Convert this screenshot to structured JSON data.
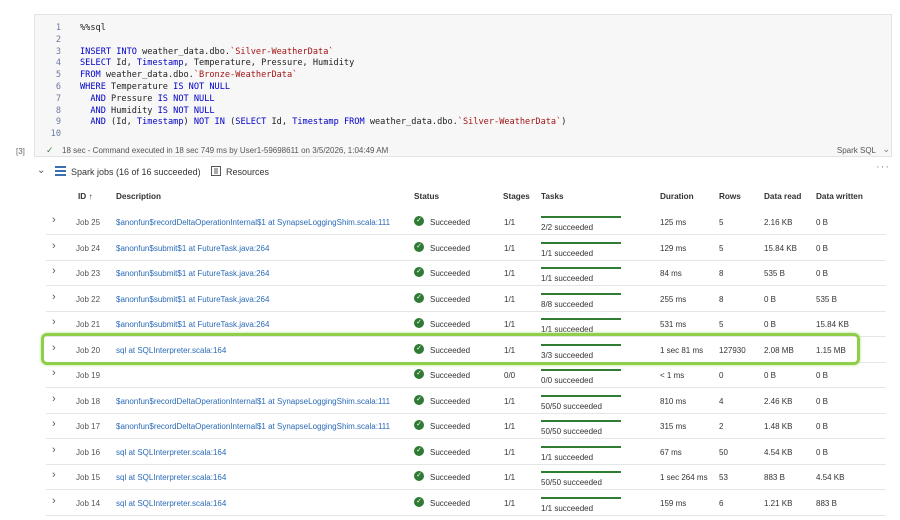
{
  "code": {
    "lines": [
      {
        "num": "1",
        "parts": [
          {
            "t": "%%sql",
            "c": ""
          }
        ]
      },
      {
        "num": "2",
        "parts": []
      },
      {
        "num": "3",
        "parts": [
          {
            "t": "INSERT INTO",
            "c": "kw"
          },
          {
            "t": " weather_data.dbo.",
            "c": ""
          },
          {
            "t": "`Silver-WeatherData`",
            "c": "str"
          }
        ]
      },
      {
        "num": "4",
        "parts": [
          {
            "t": "SELECT",
            "c": "kw"
          },
          {
            "t": " Id, ",
            "c": ""
          },
          {
            "t": "Timestamp",
            "c": "kw"
          },
          {
            "t": ", Temperature, Pressure, Humidity",
            "c": ""
          }
        ]
      },
      {
        "num": "5",
        "parts": [
          {
            "t": "FROM",
            "c": "kw"
          },
          {
            "t": " weather_data.dbo.",
            "c": ""
          },
          {
            "t": "`Bronze-WeatherData`",
            "c": "str"
          }
        ]
      },
      {
        "num": "6",
        "parts": [
          {
            "t": "WHERE",
            "c": "kw"
          },
          {
            "t": " Temperature ",
            "c": ""
          },
          {
            "t": "IS NOT NULL",
            "c": "kw"
          }
        ]
      },
      {
        "num": "7",
        "parts": [
          {
            "t": "  AND",
            "c": "kw"
          },
          {
            "t": " Pressure ",
            "c": ""
          },
          {
            "t": "IS NOT NULL",
            "c": "kw"
          }
        ]
      },
      {
        "num": "8",
        "parts": [
          {
            "t": "  AND",
            "c": "kw"
          },
          {
            "t": " Humidity ",
            "c": ""
          },
          {
            "t": "IS NOT NULL",
            "c": "kw"
          }
        ]
      },
      {
        "num": "9",
        "parts": [
          {
            "t": "  AND",
            "c": "kw"
          },
          {
            "t": " (Id, ",
            "c": ""
          },
          {
            "t": "Timestamp",
            "c": "kw"
          },
          {
            "t": ") ",
            "c": ""
          },
          {
            "t": "NOT IN",
            "c": "kw"
          },
          {
            "t": " (",
            "c": ""
          },
          {
            "t": "SELECT",
            "c": "kw"
          },
          {
            "t": " Id, ",
            "c": ""
          },
          {
            "t": "Timestamp",
            "c": "kw"
          },
          {
            "t": " ",
            "c": ""
          },
          {
            "t": "FROM",
            "c": "kw"
          },
          {
            "t": " weather_data.dbo.",
            "c": ""
          },
          {
            "t": "`Silver-WeatherData`",
            "c": "str"
          },
          {
            "t": ")",
            "c": ""
          }
        ]
      },
      {
        "num": "10",
        "parts": []
      }
    ]
  },
  "cell": {
    "exec_count": "[3]",
    "status_text": "18 sec - Command executed in 18 sec 749 ms by User1-59698611 on 3/5/2026, 1:04:49 AM",
    "language": "Spark SQL"
  },
  "jobs_section": {
    "title": "Spark jobs (16 of 16 succeeded)",
    "resources_label": "Resources",
    "more": "···"
  },
  "table": {
    "headers": {
      "id": "ID ↑",
      "description": "Description",
      "status": "Status",
      "stages": "Stages",
      "tasks": "Tasks",
      "duration": "Duration",
      "rows": "Rows",
      "data_read": "Data read",
      "data_written": "Data written"
    },
    "rows": [
      {
        "job": "Job 25",
        "desc": "$anonfun$recordDeltaOperationInternal$1 at SynapseLoggingShim.scala:111",
        "status": "Succeeded",
        "stages": "1/1",
        "tasks": "2/2 succeeded",
        "duration": "125 ms",
        "rows": "5",
        "read": "2.16 KB",
        "written": "0 B"
      },
      {
        "job": "Job 24",
        "desc": "$anonfun$submit$1 at FutureTask.java:264",
        "status": "Succeeded",
        "stages": "1/1",
        "tasks": "1/1 succeeded",
        "duration": "129 ms",
        "rows": "5",
        "read": "15.84 KB",
        "written": "0 B"
      },
      {
        "job": "Job 23",
        "desc": "$anonfun$submit$1 at FutureTask.java:264",
        "status": "Succeeded",
        "stages": "1/1",
        "tasks": "1/1 succeeded",
        "duration": "84 ms",
        "rows": "8",
        "read": "535 B",
        "written": "0 B"
      },
      {
        "job": "Job 22",
        "desc": "$anonfun$submit$1 at FutureTask.java:264",
        "status": "Succeeded",
        "stages": "1/1",
        "tasks": "8/8 succeeded",
        "duration": "255 ms",
        "rows": "8",
        "read": "0 B",
        "written": "535 B"
      },
      {
        "job": "Job 21",
        "desc": "$anonfun$submit$1 at FutureTask.java:264",
        "status": "Succeeded",
        "stages": "1/1",
        "tasks": "1/1 succeeded",
        "duration": "531 ms",
        "rows": "5",
        "read": "0 B",
        "written": "15.84 KB"
      },
      {
        "job": "Job 20",
        "desc": "sql at SQLInterpreter.scala:164",
        "status": "Succeeded",
        "stages": "1/1",
        "tasks": "3/3 succeeded",
        "duration": "1 sec 81 ms",
        "rows": "127930",
        "read": "2.08 MB",
        "written": "1.15 MB"
      },
      {
        "job": "Job 19",
        "desc": "",
        "status": "Succeeded",
        "stages": "0/0",
        "tasks": "0/0 succeeded",
        "duration": "< 1 ms",
        "rows": "0",
        "read": "0 B",
        "written": "0 B"
      },
      {
        "job": "Job 18",
        "desc": "$anonfun$recordDeltaOperationInternal$1 at SynapseLoggingShim.scala:111",
        "status": "Succeeded",
        "stages": "1/1",
        "tasks": "50/50 succeeded",
        "duration": "810 ms",
        "rows": "4",
        "read": "2.46 KB",
        "written": "0 B"
      },
      {
        "job": "Job 17",
        "desc": "$anonfun$recordDeltaOperationInternal$1 at SynapseLoggingShim.scala:111",
        "status": "Succeeded",
        "stages": "1/1",
        "tasks": "50/50 succeeded",
        "duration": "315 ms",
        "rows": "2",
        "read": "1.48 KB",
        "written": "0 B"
      },
      {
        "job": "Job 16",
        "desc": "sql at SQLInterpreter.scala:164",
        "status": "Succeeded",
        "stages": "1/1",
        "tasks": "1/1 succeeded",
        "duration": "67 ms",
        "rows": "50",
        "read": "4.54 KB",
        "written": "0 B"
      },
      {
        "job": "Job 15",
        "desc": "sql at SQLInterpreter.scala:164",
        "status": "Succeeded",
        "stages": "1/1",
        "tasks": "50/50 succeeded",
        "duration": "1 sec 264 ms",
        "rows": "53",
        "read": "883 B",
        "written": "4.54 KB"
      },
      {
        "job": "Job 14",
        "desc": "sql at SQLInterpreter.scala:164",
        "status": "Succeeded",
        "stages": "1/1",
        "tasks": "1/1 succeeded",
        "duration": "159 ms",
        "rows": "6",
        "read": "1.21 KB",
        "written": "883 B"
      }
    ]
  }
}
